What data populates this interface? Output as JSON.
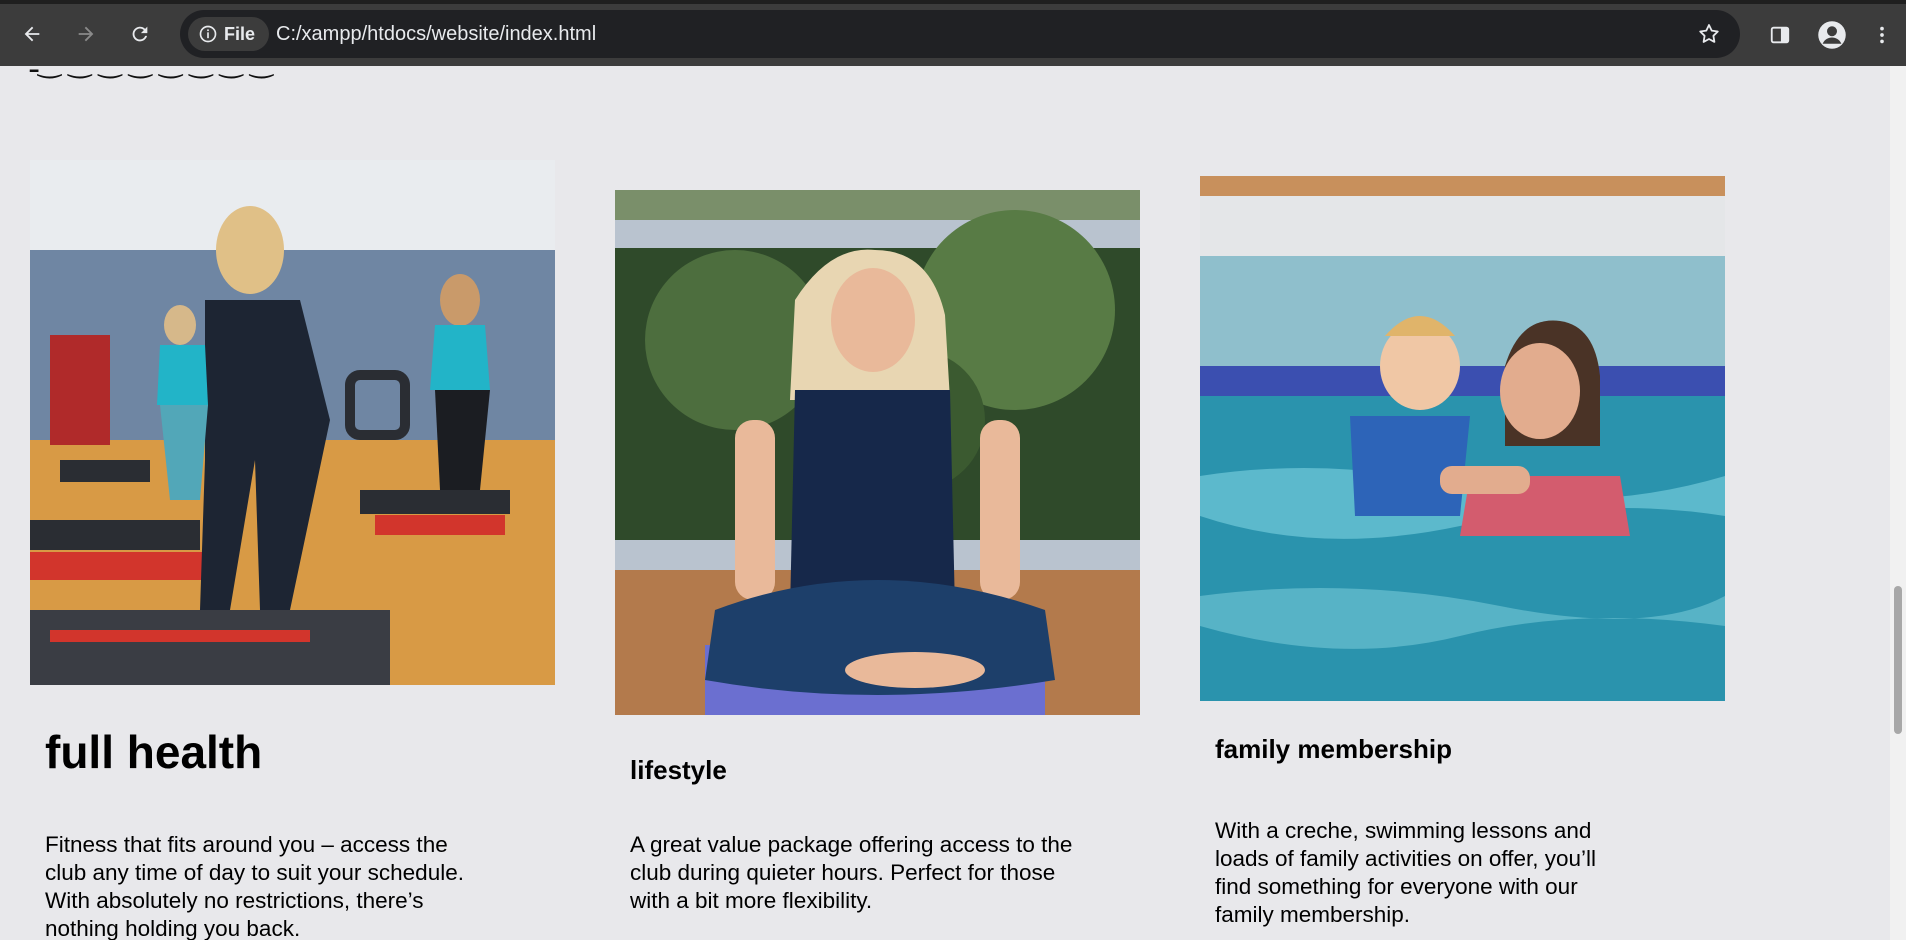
{
  "browser": {
    "site_chip_label": "File",
    "url": "C:/xampp/htdocs/website/index.html"
  },
  "page": {
    "cards": [
      {
        "title": "full health",
        "description": "Fitness that fits around you – access the club any time of day to suit your schedule. With absolutely no restrictions, there’s nothing holding you back."
      },
      {
        "title": "lifestyle",
        "description": "A great value package offering access to the club during quieter hours. Perfect for those with a bit more flexibility."
      },
      {
        "title": "family membership",
        "description": "With a creche, swimming lessons and loads of family activities on offer, you’ll find something for everyone with our family membership."
      }
    ]
  },
  "colors": {
    "page_background": "#e8e8eb",
    "chrome_background": "#3c3c3c",
    "omnibox_background": "#202124"
  }
}
